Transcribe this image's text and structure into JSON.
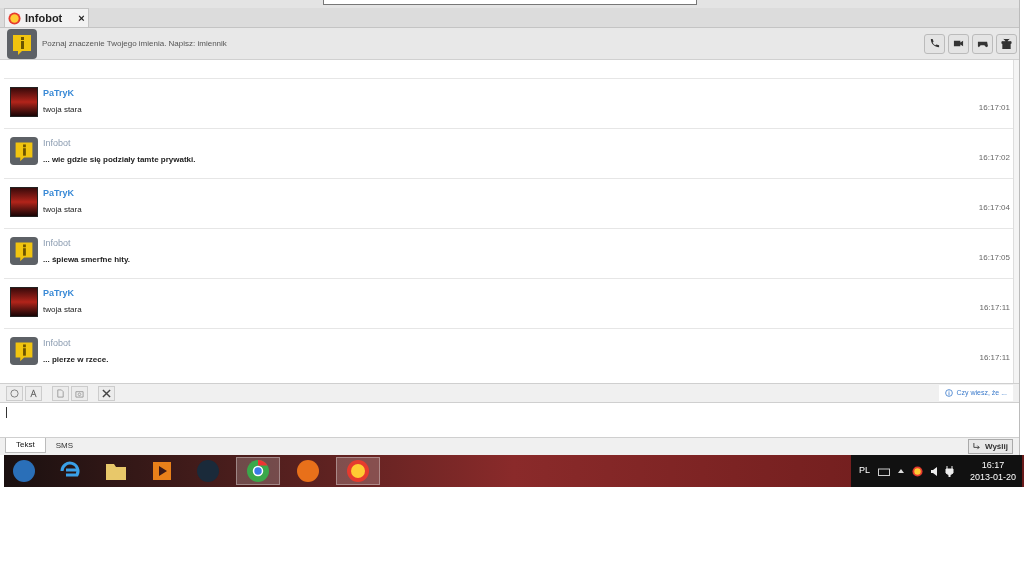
{
  "tab": {
    "title": "Infobot",
    "close": "×"
  },
  "banner": {
    "text": "Poznaj znaczenie Twojego imienia. Napisz: imiennik"
  },
  "messages": [
    {
      "kind": "user",
      "author": "PaTryK",
      "text": "twoja stara",
      "time": "16:17:01"
    },
    {
      "kind": "bot",
      "author": "Infobot",
      "text": "... wie gdzie się podziały tamte prywatki.",
      "time": "16:17:02"
    },
    {
      "kind": "user",
      "author": "PaTryK",
      "text": "twoja stara",
      "time": "16:17:04"
    },
    {
      "kind": "bot",
      "author": "Infobot",
      "text": "... śpiewa smerfne hity.",
      "time": "16:17:05"
    },
    {
      "kind": "user",
      "author": "PaTryK",
      "text": "twoja stara",
      "time": "16:17:11"
    },
    {
      "kind": "bot",
      "author": "Infobot",
      "text": "... pierze w rzece.",
      "time": "16:17:11"
    }
  ],
  "tip": "Czy wiesz, że ...",
  "input_tabs": [
    {
      "label": "Tekst",
      "selected": true
    },
    {
      "label": "SMS",
      "selected": false
    }
  ],
  "send": "Wyślij",
  "tray": {
    "lang": "PL",
    "time": "16:17",
    "date": "2013-01-20"
  }
}
